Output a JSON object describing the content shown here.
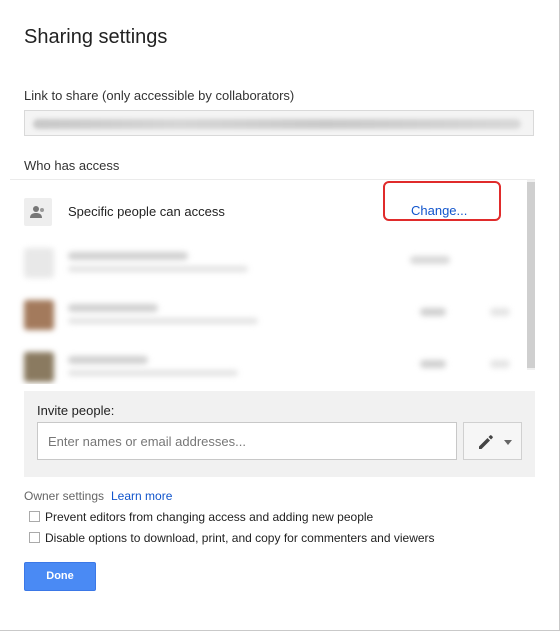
{
  "dialog": {
    "title": "Sharing settings"
  },
  "link": {
    "label": "Link to share (only accessible by collaborators)"
  },
  "access": {
    "label": "Who has access",
    "current": "Specific people can access",
    "change_label": "Change...",
    "highlight_color": "#e02b2b"
  },
  "invite": {
    "label": "Invite people:",
    "placeholder": "Enter names or email addresses...",
    "permission_icon": "pencil-icon"
  },
  "owner_settings": {
    "label": "Owner settings",
    "learn_more": "Learn more",
    "options": [
      {
        "label": "Prevent editors from changing access and adding new people",
        "checked": false
      },
      {
        "label": "Disable options to download, print, and copy for commenters and viewers",
        "checked": false
      }
    ]
  },
  "actions": {
    "done_label": "Done",
    "accent": "#4a8af4"
  }
}
